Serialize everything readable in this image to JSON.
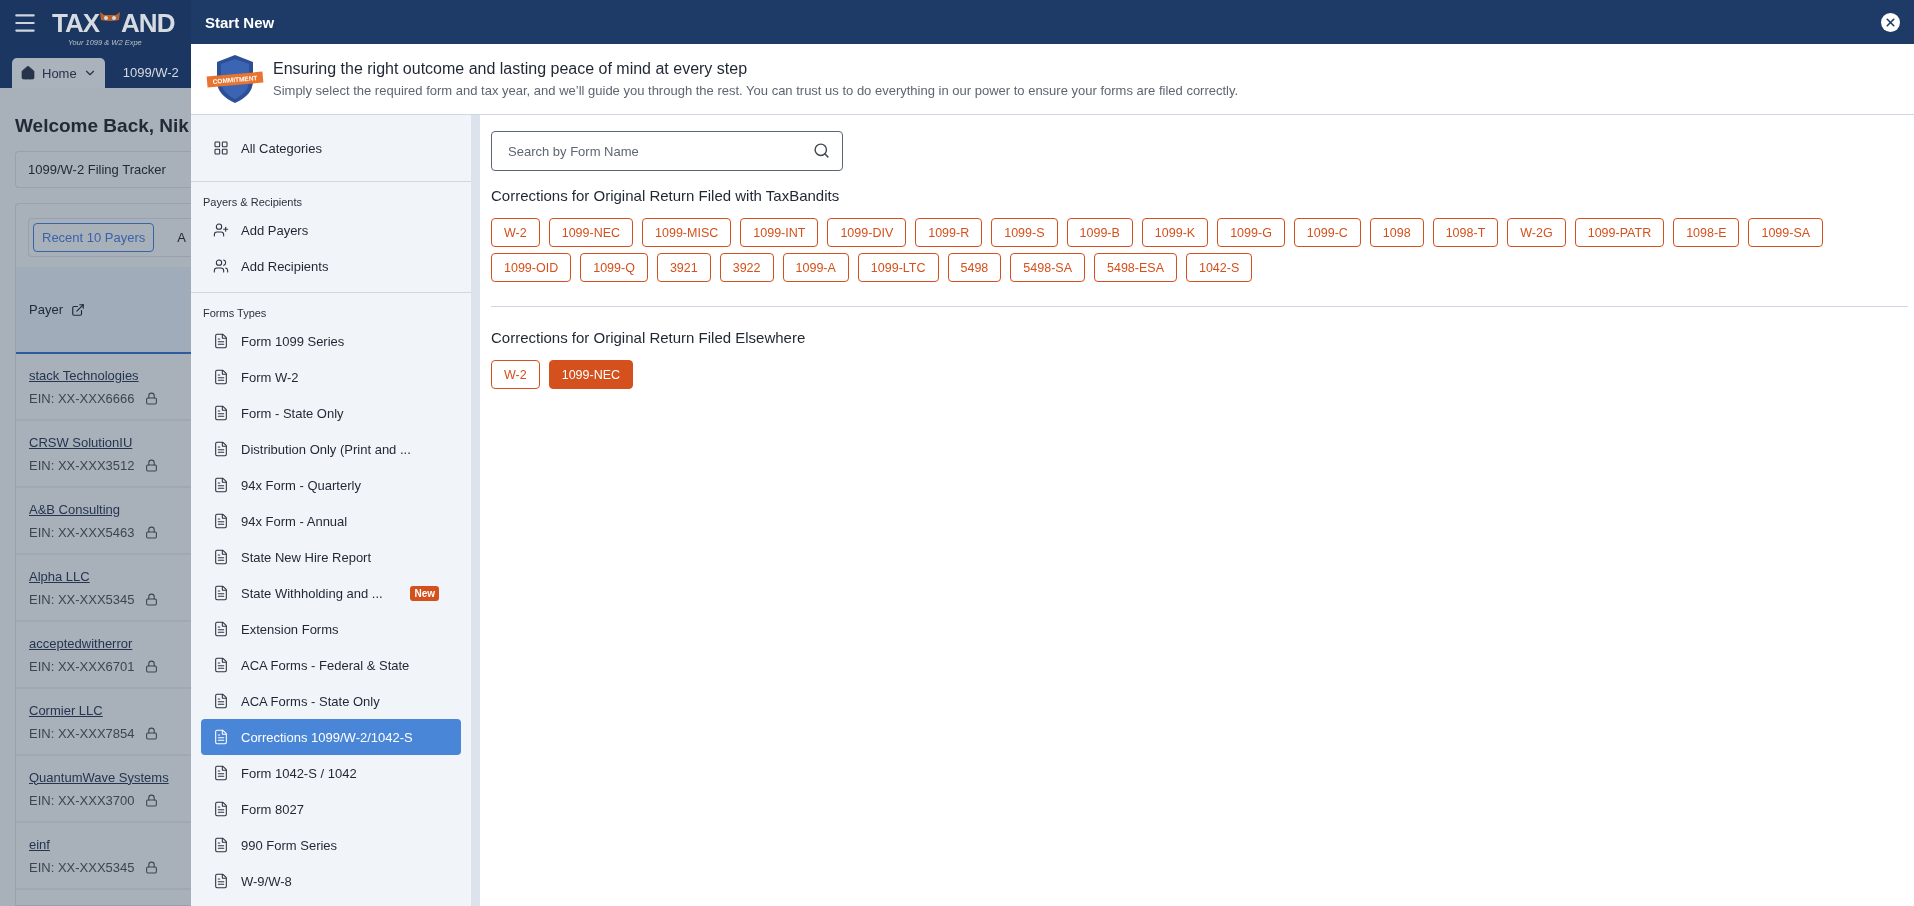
{
  "background": {
    "logo_left": "TAX",
    "logo_right": "AND",
    "tagline": "Your 1099 & W2 Expe",
    "nav_tabs": [
      {
        "label": "Home",
        "selected": true
      },
      {
        "label": "1099/W-2",
        "selected": false
      }
    ],
    "welcome": "Welcome Back, Nik",
    "tracker": "1099/W-2 Filing Tracker",
    "filters": [
      {
        "label": "Recent 10 Payers",
        "selected": true
      },
      {
        "label": "A",
        "selected": false
      }
    ],
    "column": "Payer",
    "payers": [
      {
        "name": "stack Technologies",
        "ein": "EIN: XX-XXX6666"
      },
      {
        "name": "CRSW SolutionIU",
        "ein": "EIN: XX-XXX3512"
      },
      {
        "name": "A&B Consulting",
        "ein": "EIN: XX-XXX5463"
      },
      {
        "name": "Alpha LLC",
        "ein": "EIN: XX-XXX5345"
      },
      {
        "name": "acceptedwitherror",
        "ein": "EIN: XX-XXX6701"
      },
      {
        "name": "Cormier LLC",
        "ein": "EIN: XX-XXX7854"
      },
      {
        "name": "QuantumWave Systems",
        "ein": "EIN: XX-XXX3700"
      },
      {
        "name": "einf",
        "ein": "EIN: XX-XXX5345"
      }
    ]
  },
  "dialog": {
    "title": "Start New",
    "banner": {
      "ribbon": "COMMITMENT",
      "heading": "Ensuring the right outcome and lasting peace of mind at every step",
      "text": "Simply select the required form and tax year, and we’ll guide you through the rest. You can trust us to do everything in our power to ensure your forms are filed correctly."
    },
    "all_categories": {
      "label": "All Categories",
      "selected": false
    },
    "sections": [
      {
        "title": "Payers & Recipients",
        "items": [
          {
            "label": "Add Payers",
            "kind": "add-person",
            "selected": false
          },
          {
            "label": "Add Recipients",
            "kind": "people",
            "selected": false
          }
        ]
      },
      {
        "title": "Forms Types",
        "items": [
          {
            "label": "Form 1099 Series",
            "kind": "document",
            "selected": false
          },
          {
            "label": "Form W-2",
            "kind": "document",
            "selected": false
          },
          {
            "label": "Form - State Only",
            "kind": "document",
            "selected": false
          },
          {
            "label": "Distribution Only (Print and ...",
            "kind": "document",
            "selected": false
          },
          {
            "label": "94x Form - Quarterly",
            "kind": "document",
            "selected": false
          },
          {
            "label": "94x Form - Annual",
            "kind": "document",
            "selected": false
          },
          {
            "label": "State New Hire Report",
            "kind": "document",
            "selected": false
          },
          {
            "label": "State Withholding and ...",
            "kind": "document",
            "selected": false,
            "badge": "New"
          },
          {
            "label": "Extension Forms",
            "kind": "document",
            "selected": false
          },
          {
            "label": "ACA Forms - Federal & State",
            "kind": "document",
            "selected": false
          },
          {
            "label": "ACA Forms - State Only",
            "kind": "document",
            "selected": false
          },
          {
            "label": "Corrections 1099/W-2/1042-S",
            "kind": "document",
            "selected": true
          },
          {
            "label": "Form 1042-S / 1042",
            "kind": "document",
            "selected": false
          },
          {
            "label": "Form 8027",
            "kind": "document",
            "selected": false
          },
          {
            "label": "990 Form Series",
            "kind": "document",
            "selected": false
          },
          {
            "label": "W-9/W-8",
            "kind": "document",
            "selected": false
          }
        ]
      }
    ],
    "search": {
      "placeholder": "Search by Form Name"
    },
    "groups": [
      {
        "title": "Corrections for Original Return Filed with TaxBandits",
        "forms": [
          {
            "label": "W-2",
            "selected": false
          },
          {
            "label": "1099-NEC",
            "selected": false
          },
          {
            "label": "1099-MISC",
            "selected": false
          },
          {
            "label": "1099-INT",
            "selected": false
          },
          {
            "label": "1099-DIV",
            "selected": false
          },
          {
            "label": "1099-R",
            "selected": false
          },
          {
            "label": "1099-S",
            "selected": false
          },
          {
            "label": "1099-B",
            "selected": false
          },
          {
            "label": "1099-K",
            "selected": false
          },
          {
            "label": "1099-G",
            "selected": false
          },
          {
            "label": "1099-C",
            "selected": false
          },
          {
            "label": "1098",
            "selected": false
          },
          {
            "label": "1098-T",
            "selected": false
          },
          {
            "label": "W-2G",
            "selected": false
          },
          {
            "label": "1099-PATR",
            "selected": false
          },
          {
            "label": "1098-E",
            "selected": false
          },
          {
            "label": "1099-SA",
            "selected": false
          },
          {
            "label": "1099-OID",
            "selected": false
          },
          {
            "label": "1099-Q",
            "selected": false
          },
          {
            "label": "3921",
            "selected": false
          },
          {
            "label": "3922",
            "selected": false
          },
          {
            "label": "1099-A",
            "selected": false
          },
          {
            "label": "1099-LTC",
            "selected": false
          },
          {
            "label": "5498",
            "selected": false
          },
          {
            "label": "5498-SA",
            "selected": false
          },
          {
            "label": "5498-ESA",
            "selected": false
          },
          {
            "label": "1042-S",
            "selected": false
          }
        ]
      },
      {
        "title": "Corrections for Original Return Filed Elsewhere",
        "forms": [
          {
            "label": "W-2",
            "selected": false
          },
          {
            "label": "1099-NEC",
            "selected": true
          }
        ]
      }
    ]
  }
}
